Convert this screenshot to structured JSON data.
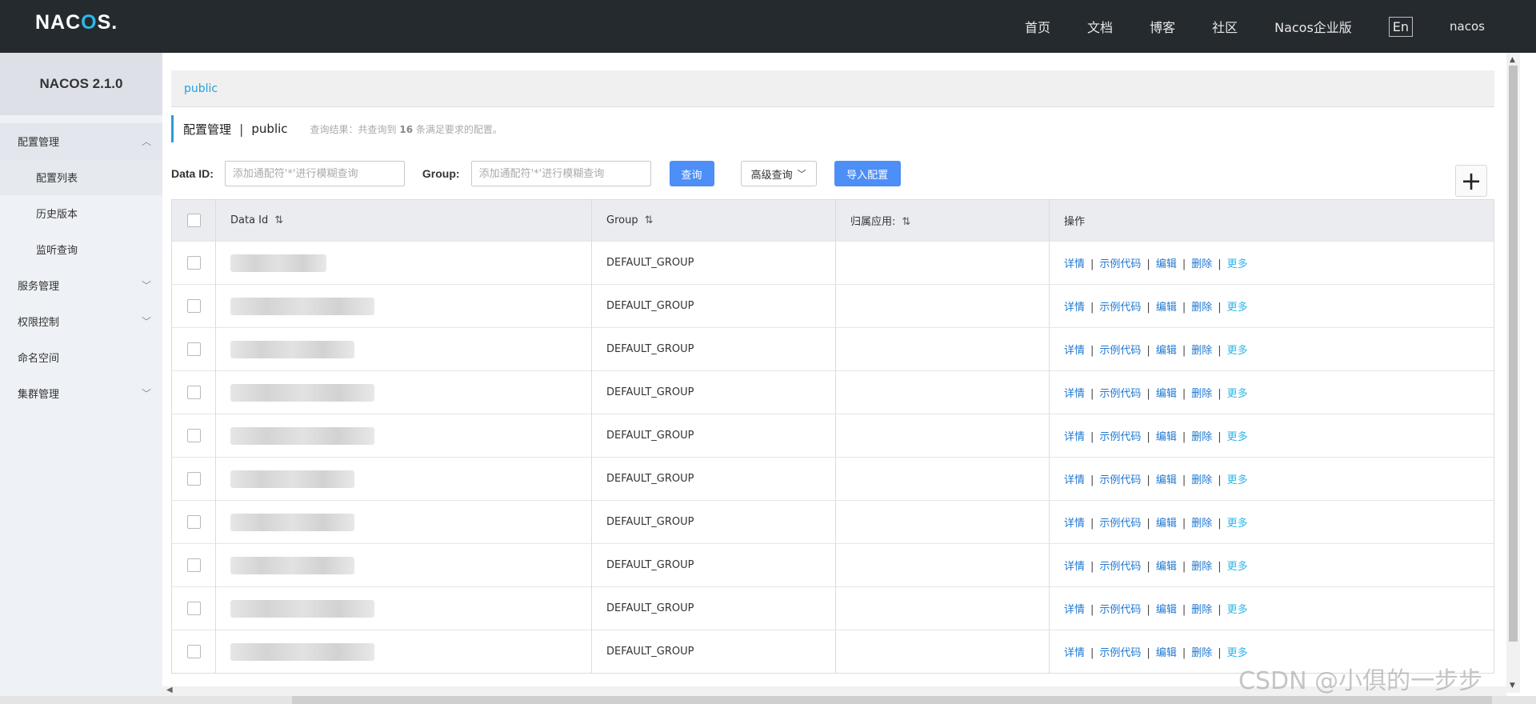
{
  "header": {
    "logo_prefix": "NA",
    "logo_mid": "C",
    "logo_o": "O",
    "logo_suffix": "S.",
    "nav": [
      "首页",
      "文档",
      "博客",
      "社区",
      "Nacos企业版"
    ],
    "lang": "En",
    "user": "nacos"
  },
  "sidebar": {
    "version": "NACOS 2.1.0",
    "config_group": "配置管理",
    "config_items": [
      "配置列表",
      "历史版本",
      "监听查询"
    ],
    "service_group": "服务管理",
    "auth_group": "权限控制",
    "namespace": "命名空间",
    "cluster_group": "集群管理"
  },
  "breadcrumb": {
    "namespace": "public"
  },
  "title": {
    "label": "配置管理",
    "separator": "|",
    "namespace": "public",
    "result_prefix": "查询结果：共查询到",
    "result_count": "16",
    "result_suffix": "条满足要求的配置。"
  },
  "filter": {
    "dataid_label": "Data ID:",
    "dataid_placeholder": "添加通配符'*'进行模糊查询",
    "group_label": "Group:",
    "group_placeholder": "添加通配符'*'进行模糊查询",
    "search_label": "查询",
    "advanced_label": "高级查询",
    "import_label": "导入配置"
  },
  "table": {
    "headers": [
      "Data Id",
      "Group",
      "归属应用:",
      "操作"
    ],
    "rows": [
      {
        "group": "DEFAULT_GROUP"
      },
      {
        "group": "DEFAULT_GROUP"
      },
      {
        "group": "DEFAULT_GROUP"
      },
      {
        "group": "DEFAULT_GROUP"
      },
      {
        "group": "DEFAULT_GROUP"
      },
      {
        "group": "DEFAULT_GROUP"
      },
      {
        "group": "DEFAULT_GROUP"
      },
      {
        "group": "DEFAULT_GROUP"
      },
      {
        "group": "DEFAULT_GROUP"
      },
      {
        "group": "DEFAULT_GROUP"
      }
    ],
    "ops": {
      "detail": "详情",
      "sample": "示例代码",
      "edit": "编辑",
      "delete": "删除",
      "more": "更多"
    }
  },
  "watermark": "CSDN @小俱的一步步"
}
